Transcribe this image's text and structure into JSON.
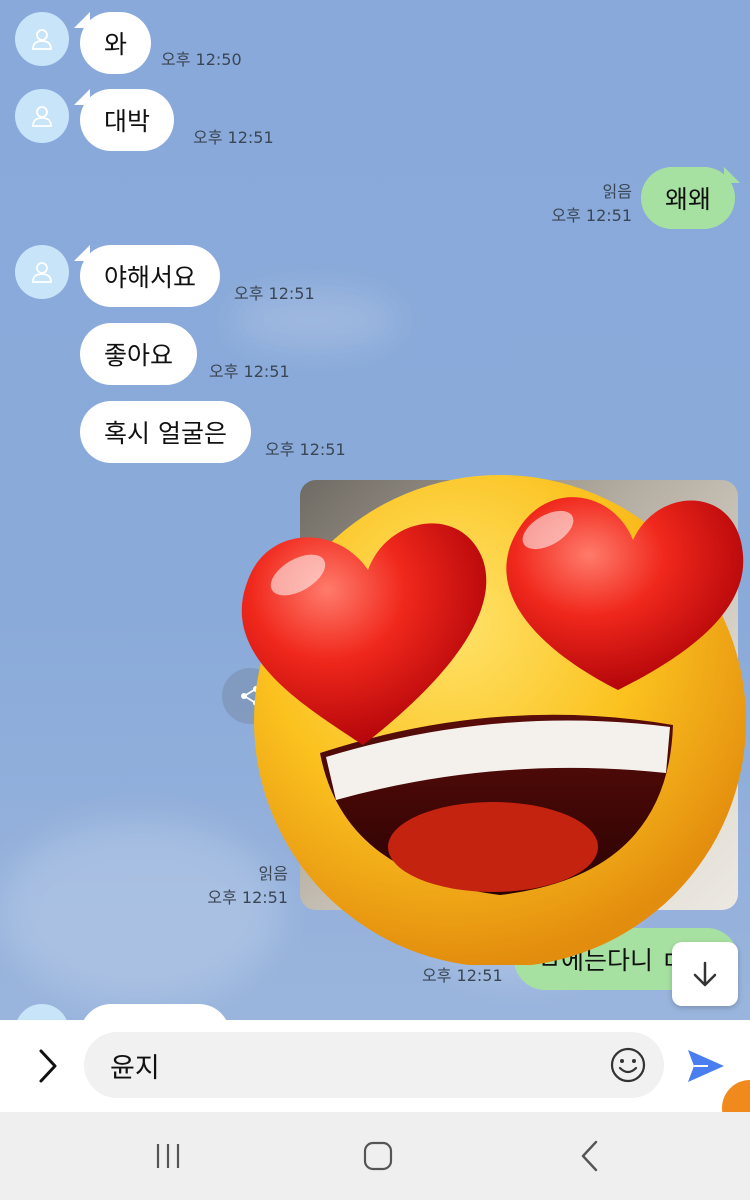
{
  "chat": {
    "messages": [
      {
        "text": "와",
        "time": "오후 12:50"
      },
      {
        "text": "대박",
        "time": "오후 12:51"
      },
      {
        "text": "왜왜",
        "time": "오후 12:51",
        "read": "읽음"
      },
      {
        "text": "야해서요",
        "time": "오후 12:51"
      },
      {
        "text": "좋아요",
        "time": "오후 12:51"
      },
      {
        "text": "혹시 얼굴은",
        "time": "오후 12:51"
      },
      {
        "time": "오후 12:51",
        "read": "읽음"
      },
      {
        "text": "ㅁ에는다니 ㄷ",
        "time": "오후 12:51"
      }
    ]
  },
  "input": {
    "value": "윤지"
  },
  "icons": {
    "avatar": "person-icon",
    "share": "share-icon",
    "scroll": "arrow-down-icon",
    "expand": "chevron-right-icon",
    "emoji": "smiley-icon",
    "send": "send-icon",
    "sticker": "heart-eyes-emoji"
  },
  "colors": {
    "background": "#8aaad8",
    "incoming_bubble": "#ffffff",
    "outgoing_bubble": "#a7e1a1",
    "send_accent": "#4a7ef0"
  }
}
